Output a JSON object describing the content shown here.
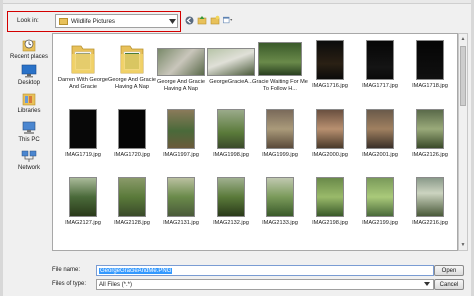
{
  "look_in": {
    "label": "Look in:",
    "value": "Wildlife Pictures"
  },
  "toolbar": {
    "buttons": [
      "back-icon",
      "up-folder-icon",
      "new-folder-icon",
      "view-menu-icon"
    ]
  },
  "places": [
    {
      "label": "Recent places",
      "icon": "recent-places-icon"
    },
    {
      "label": "Desktop",
      "icon": "desktop-icon"
    },
    {
      "label": "Libraries",
      "icon": "libraries-icon"
    },
    {
      "label": "This PC",
      "icon": "computer-icon"
    },
    {
      "label": "Network",
      "icon": "network-icon"
    }
  ],
  "files": [
    {
      "name": "Darren With George And Gracie",
      "kind": "folder"
    },
    {
      "name": "George And Gracie Having A Nap",
      "kind": "folder"
    },
    {
      "name": "George And Gracie Having A Nap",
      "kind": "image"
    },
    {
      "name": "GeorgeGracieA...",
      "kind": "image"
    },
    {
      "name": "Gracie Waiting For Me To Follow H...",
      "kind": "image"
    },
    {
      "name": "IMAG1716.jpg",
      "kind": "image"
    },
    {
      "name": "IMAG1717.jpg",
      "kind": "image"
    },
    {
      "name": "IMAG1718.jpg",
      "kind": "image"
    },
    {
      "name": "IMAG1719.jpg",
      "kind": "image"
    },
    {
      "name": "IMAG1720.jpg",
      "kind": "image"
    },
    {
      "name": "IMAG1997.jpg",
      "kind": "image"
    },
    {
      "name": "IMAG1998.jpg",
      "kind": "image"
    },
    {
      "name": "IMAG1999.jpg",
      "kind": "image"
    },
    {
      "name": "IMAG2000.jpg",
      "kind": "image"
    },
    {
      "name": "IMAG2001.jpg",
      "kind": "image"
    },
    {
      "name": "IMAG2126.jpg",
      "kind": "image"
    },
    {
      "name": "IMAG2127.jpg",
      "kind": "image"
    },
    {
      "name": "IMAG2128.jpg",
      "kind": "image"
    },
    {
      "name": "IMAG2131.jpg",
      "kind": "image"
    },
    {
      "name": "IMAG2132.jpg",
      "kind": "image"
    },
    {
      "name": "IMAG2133.jpg",
      "kind": "image"
    },
    {
      "name": "IMAG2198.jpg",
      "kind": "image"
    },
    {
      "name": "IMAG2199.jpg",
      "kind": "image"
    },
    {
      "name": "IMAG2216.jpg",
      "kind": "image"
    }
  ],
  "form": {
    "file_name_label": "File name:",
    "file_name_value": "GeorgeGracieAndMe.PNG",
    "file_type_label": "Files of type:",
    "file_type_value": "All Files (*.*)",
    "open_label": "Open",
    "cancel_label": "Cancel"
  },
  "colors": {
    "accent_outline": "#d40000",
    "selection": "#3399ff",
    "folder": "#e8c15a"
  }
}
